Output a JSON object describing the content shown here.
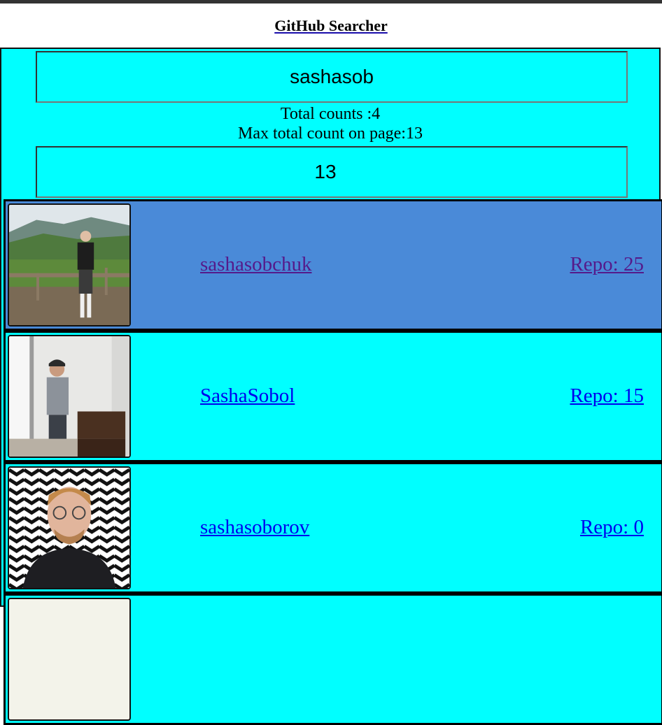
{
  "app": {
    "title": "GitHub Searcher"
  },
  "search": {
    "query": "sashasob",
    "per_page": "13",
    "total_counts_label": "Total counts :4",
    "max_count_label": "Max total count on page:13"
  },
  "users": [
    {
      "login": "sashasobchuk",
      "repo_label": "Repo: 25",
      "active": true
    },
    {
      "login": "SashaSobol",
      "repo_label": "Repo: 15",
      "active": false
    },
    {
      "login": "sashasoborov",
      "repo_label": "Repo: 0",
      "active": false
    }
  ],
  "colors": {
    "page_bg": "#00ffff",
    "active_row": "#4a8ad8",
    "link": "#0000ee",
    "visited_link": "#551a8b"
  }
}
